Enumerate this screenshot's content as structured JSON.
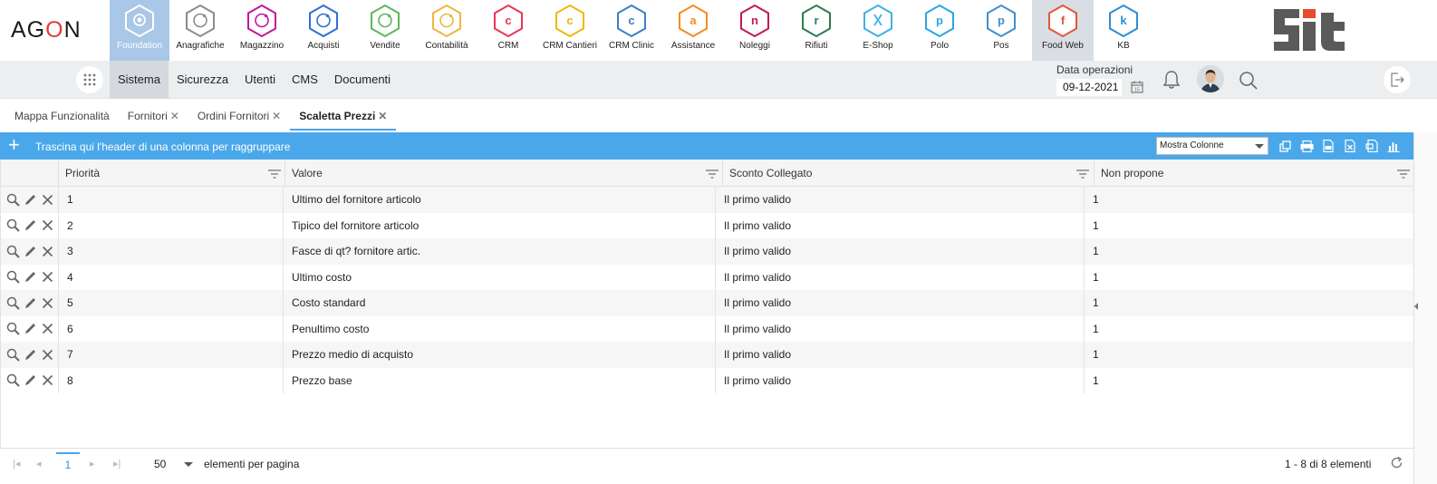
{
  "app": {
    "logo_text": "AGON",
    "brand_logo": "Sit"
  },
  "modules": [
    {
      "label": "Foundation",
      "color": "#ffffff",
      "letter": "",
      "state": "active"
    },
    {
      "label": "Anagrafiche",
      "color": "#8c8c8c",
      "letter": "",
      "state": ""
    },
    {
      "label": "Magazzino",
      "color": "#c2179b",
      "letter": "",
      "state": ""
    },
    {
      "label": "Acquisti",
      "color": "#2f6fd6",
      "letter": "",
      "state": ""
    },
    {
      "label": "Vendite",
      "color": "#5cb85c",
      "letter": "",
      "state": ""
    },
    {
      "label": "Contabilità",
      "color": "#f0b542",
      "letter": "",
      "state": ""
    },
    {
      "label": "CRM",
      "color": "#e8384f",
      "letter": "c",
      "state": ""
    },
    {
      "label": "CRM Cantieri",
      "color": "#f2b705",
      "letter": "c",
      "state": ""
    },
    {
      "label": "CRM Clinic",
      "color": "#3c7fc9",
      "letter": "c",
      "state": ""
    },
    {
      "label": "Assistance",
      "color": "#f28c1e",
      "letter": "a",
      "state": ""
    },
    {
      "label": "Noleggi",
      "color": "#c2185b",
      "letter": "n",
      "state": ""
    },
    {
      "label": "Rifiuti",
      "color": "#2e7d4f",
      "letter": "r",
      "state": ""
    },
    {
      "label": "E-Shop",
      "color": "#3fb0e6",
      "letter": "",
      "state": ""
    },
    {
      "label": "Polo",
      "color": "#29a7e1",
      "letter": "p",
      "state": ""
    },
    {
      "label": "Pos",
      "color": "#3f8fd0",
      "letter": "p",
      "state": ""
    },
    {
      "label": "Food Web",
      "color": "#e2573b",
      "letter": "f",
      "state": "selected"
    },
    {
      "label": "KB",
      "color": "#2b8fd6",
      "letter": "k",
      "state": ""
    }
  ],
  "submenu": [
    {
      "label": "Sistema",
      "active": true
    },
    {
      "label": "Sicurezza",
      "active": false
    },
    {
      "label": "Utenti",
      "active": false
    },
    {
      "label": "CMS",
      "active": false
    },
    {
      "label": "Documenti",
      "active": false
    }
  ],
  "date_operations": {
    "label": "Data operazioni",
    "value": "09-12-2021",
    "calendar_day": "15"
  },
  "tabs": [
    {
      "label": "Mappa Funzionalità",
      "closable": false,
      "active": false
    },
    {
      "label": "Fornitori",
      "closable": true,
      "active": false
    },
    {
      "label": "Ordini Fornitori",
      "closable": true,
      "active": false
    },
    {
      "label": "Scaletta Prezzi",
      "closable": true,
      "active": true
    }
  ],
  "toolbar": {
    "group_hint": "Trascina qui l'header di una colonna per raggruppare",
    "columns_select": "Mostra Colonne"
  },
  "grid": {
    "columns": [
      "Priorità",
      "Valore",
      "Sconto Collegato",
      "Non propone"
    ],
    "rows": [
      {
        "priorita": "1",
        "valore": "Ultimo del fornitore articolo",
        "sconto": "Il primo valido",
        "non_propone": "1"
      },
      {
        "priorita": "2",
        "valore": "Tipico del fornitore articolo",
        "sconto": "Il primo valido",
        "non_propone": "1"
      },
      {
        "priorita": "3",
        "valore": "Fasce di qt? fornitore artic.",
        "sconto": "Il primo valido",
        "non_propone": "1"
      },
      {
        "priorita": "4",
        "valore": "Ultimo costo",
        "sconto": "Il primo valido",
        "non_propone": "1"
      },
      {
        "priorita": "5",
        "valore": "Costo standard",
        "sconto": "Il primo valido",
        "non_propone": "1"
      },
      {
        "priorita": "6",
        "valore": "Penultimo costo",
        "sconto": "Il primo valido",
        "non_propone": "1"
      },
      {
        "priorita": "7",
        "valore": "Prezzo medio di acquisto",
        "sconto": "Il primo valido",
        "non_propone": "1"
      },
      {
        "priorita": "8",
        "valore": "Prezzo base",
        "sconto": "Il primo valido",
        "non_propone": "1"
      }
    ]
  },
  "pager": {
    "current_page": "1",
    "page_size": "50",
    "page_size_label": "elementi per pagina",
    "info": "1 - 8 di 8 elementi"
  }
}
